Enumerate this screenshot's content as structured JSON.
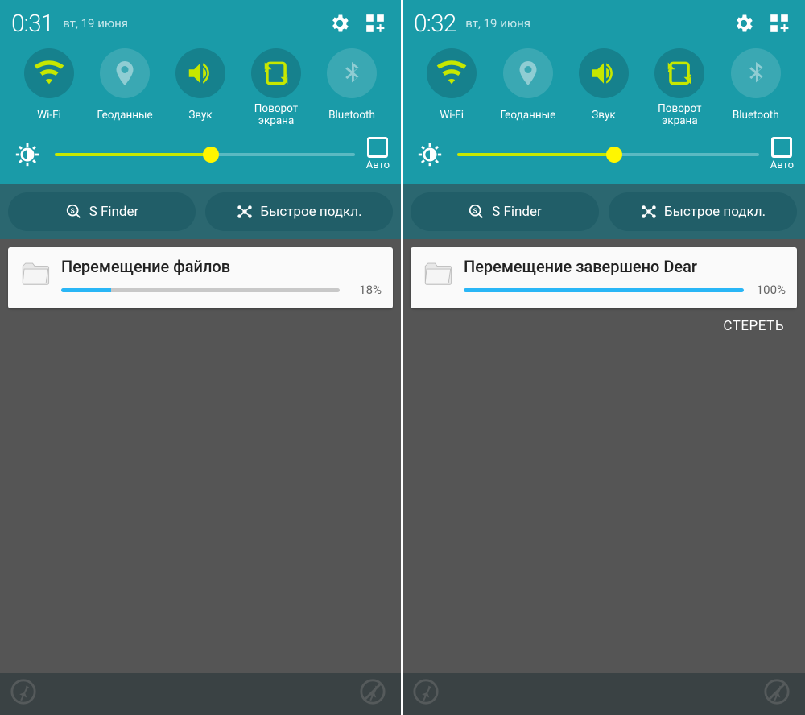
{
  "screens": [
    {
      "time": "0:31",
      "date": "вт, 19 июня",
      "toggles": [
        {
          "label": "Wi-Fi",
          "active": true,
          "icon": "wifi"
        },
        {
          "label": "Геоданные",
          "active": false,
          "icon": "location"
        },
        {
          "label": "Звук",
          "active": true,
          "icon": "sound"
        },
        {
          "label": "Поворот экрана",
          "active": true,
          "icon": "rotate"
        },
        {
          "label": "Bluetooth",
          "active": false,
          "icon": "bluetooth"
        }
      ],
      "brightness_pct": 52,
      "auto_label": "Авто",
      "pills": [
        {
          "icon": "sfinder",
          "label": "S Finder"
        },
        {
          "icon": "connect",
          "label": "Быстрое подкл."
        }
      ],
      "notification": {
        "title": "Перемещение файлов",
        "progress": 18,
        "pct_label": "18%"
      },
      "show_clear": false,
      "clear_label": ""
    },
    {
      "time": "0:32",
      "date": "вт, 19 июня",
      "toggles": [
        {
          "label": "Wi-Fi",
          "active": true,
          "icon": "wifi"
        },
        {
          "label": "Геоданные",
          "active": false,
          "icon": "location"
        },
        {
          "label": "Звук",
          "active": true,
          "icon": "sound"
        },
        {
          "label": "Поворот экрана",
          "active": true,
          "icon": "rotate"
        },
        {
          "label": "Bluetooth",
          "active": false,
          "icon": "bluetooth"
        }
      ],
      "brightness_pct": 52,
      "auto_label": "Авто",
      "pills": [
        {
          "icon": "sfinder",
          "label": "S Finder"
        },
        {
          "icon": "connect",
          "label": "Быстрое подкл."
        }
      ],
      "notification": {
        "title": "Перемещение завершено Dear",
        "progress": 100,
        "pct_label": "100%"
      },
      "show_clear": true,
      "clear_label": "СТЕРЕТЬ"
    }
  ],
  "colors": {
    "active_icon": "#c6e800",
    "inactive_icon": "#8fcdd3"
  }
}
